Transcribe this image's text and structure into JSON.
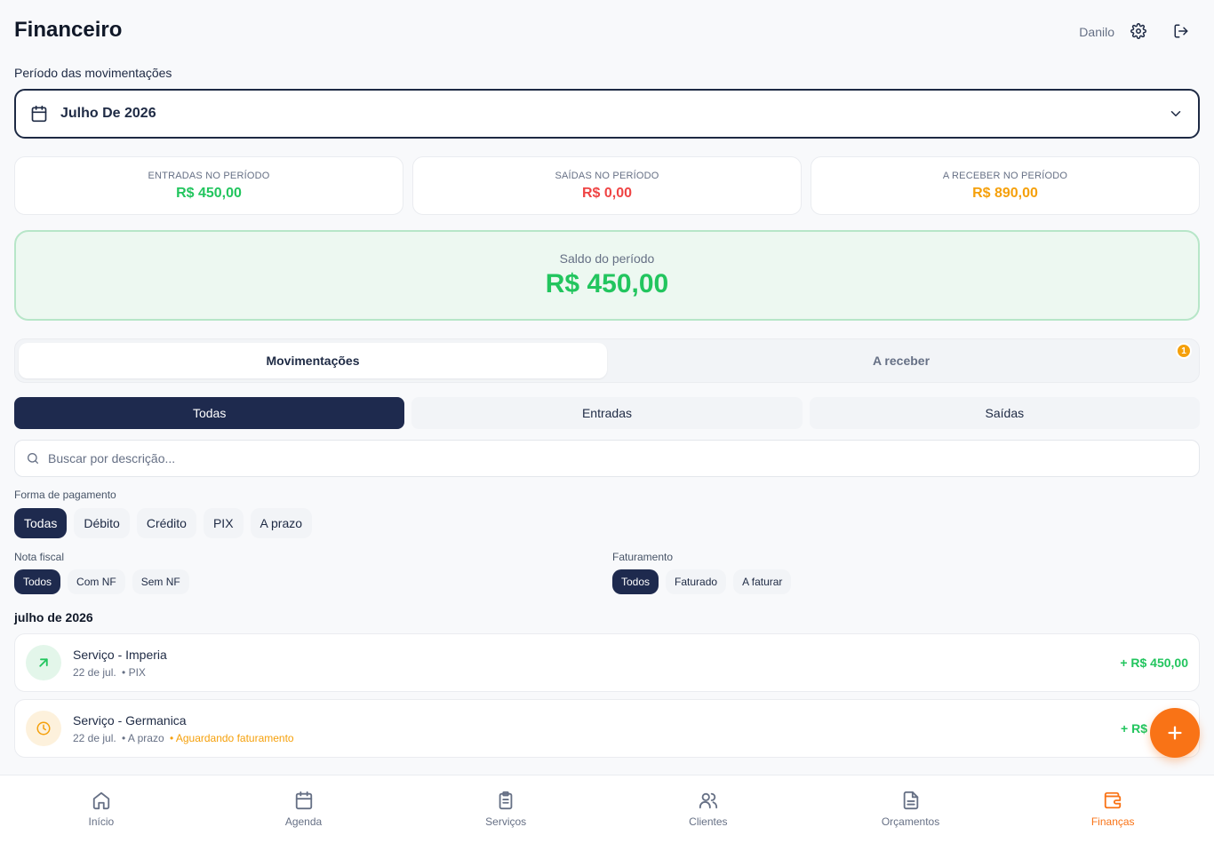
{
  "header": {
    "title": "Financeiro",
    "user_name": "Danilo",
    "settings_icon": "gear-icon",
    "logout_icon": "logout-icon"
  },
  "period": {
    "label": "Período das movimentações",
    "value": "Julho De 2026"
  },
  "summary": {
    "income": {
      "label": "ENTRADAS NO PERÍODO",
      "value": "R$ 450,00",
      "color": "#22c55e"
    },
    "expense": {
      "label": "SAÍDAS NO PERÍODO",
      "value": "R$ 0,00",
      "color": "#ef4444"
    },
    "receivable": {
      "label": "A RECEBER NO PERÍODO",
      "value": "R$ 890,00",
      "color": "#f5a00b"
    }
  },
  "balance": {
    "label": "Saldo do período",
    "value": "R$ 450,00"
  },
  "tabs": [
    {
      "label": "Movimentações",
      "active": true
    },
    {
      "label": "A receber",
      "active": false,
      "badge": "1"
    }
  ],
  "type_filter": [
    "Todas",
    "Entradas",
    "Saídas"
  ],
  "search": {
    "placeholder": "Buscar por descrição..."
  },
  "payment_filter": {
    "label": "Forma de pagamento",
    "options": [
      "Todas",
      "Débito",
      "Crédito",
      "PIX",
      "A prazo"
    ],
    "selected": "Todas"
  },
  "invoice_filter": {
    "label": "Nota fiscal",
    "options": [
      "Todos",
      "Com NF",
      "Sem NF"
    ],
    "selected": "Todos"
  },
  "billing_filter": {
    "label": "Faturamento",
    "options": [
      "Todos",
      "Faturado",
      "A faturar"
    ],
    "selected": "Todos"
  },
  "month_group": "julho de 2026",
  "transactions": [
    {
      "title": "Serviço - Imperia",
      "date": "22 de jul.",
      "method": "• PIX",
      "status": "",
      "amount": "+ R$ 450,00",
      "icon": "arrow-up-right-icon"
    },
    {
      "title": "Serviço - Germanica",
      "date": "22 de jul.",
      "method": "• A prazo",
      "status": "• Aguardando faturamento",
      "amount": "+ R$",
      "icon": "clock-icon"
    }
  ],
  "bottom_nav": [
    {
      "label": "Início",
      "icon": "home-icon"
    },
    {
      "label": "Agenda",
      "icon": "calendar-icon"
    },
    {
      "label": "Serviços",
      "icon": "clipboard-icon"
    },
    {
      "label": "Clientes",
      "icon": "users-icon"
    },
    {
      "label": "Orçamentos",
      "icon": "document-icon"
    },
    {
      "label": "Finanças",
      "icon": "wallet-icon",
      "active": true
    }
  ],
  "colors": {
    "primary": "#1e2a4e",
    "accent": "#f97316",
    "positive": "#22c55e",
    "negative": "#ef4444",
    "pending": "#f5a00b"
  }
}
